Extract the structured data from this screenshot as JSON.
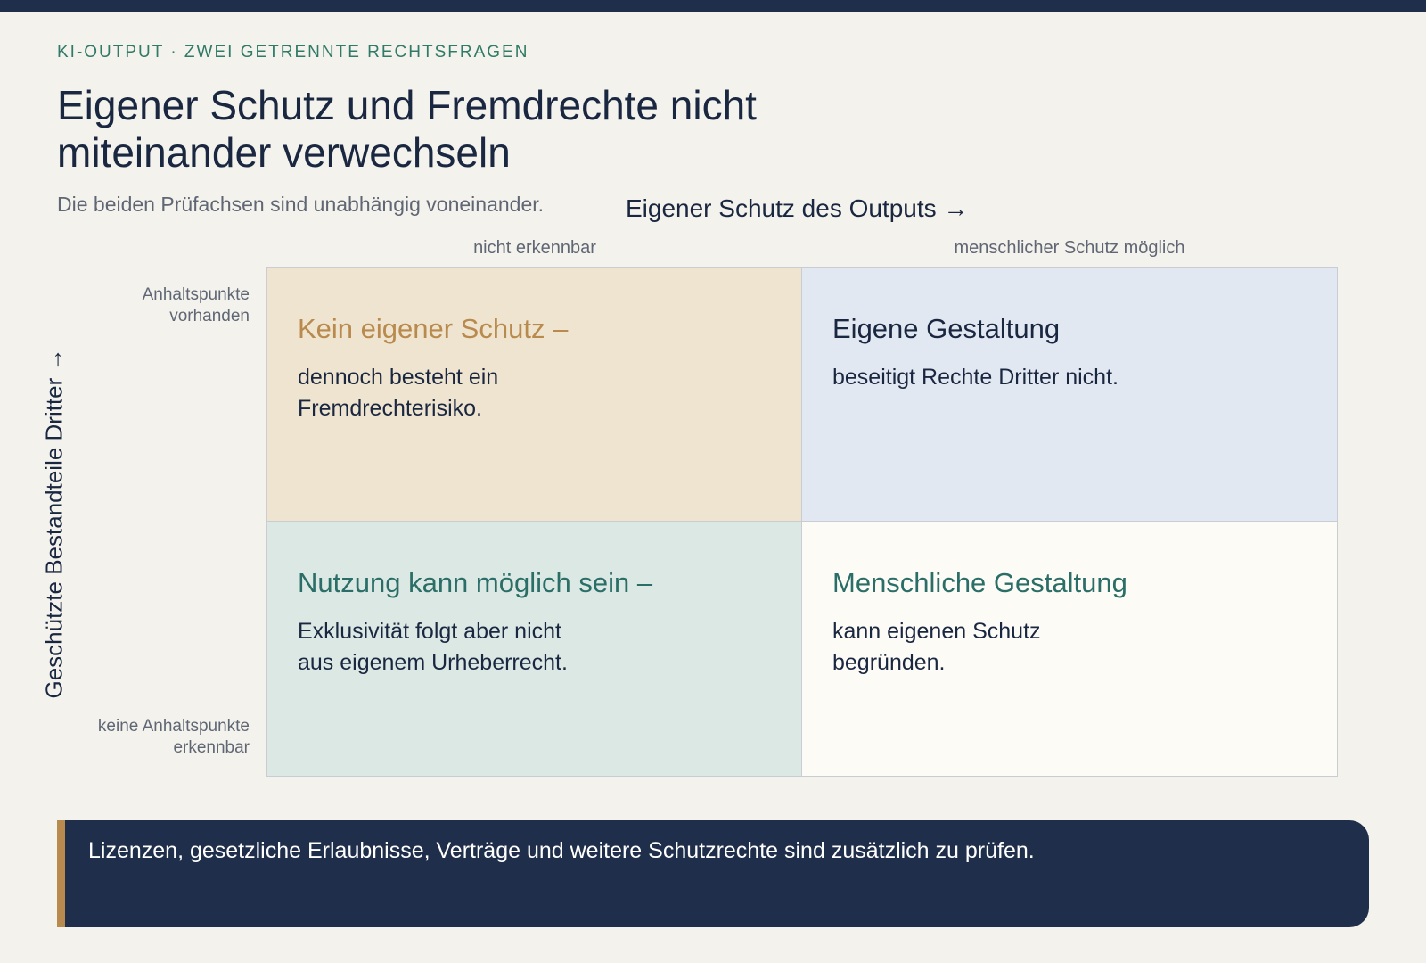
{
  "eyebrow": "KI-OUTPUT · ZWEI GETRENNTE RECHTSFRAGEN",
  "title": "Eigener Schutz und Fremdrechte nicht miteinander verwechseln",
  "subtitle": "Die beiden Prüfachsen sind unabhängig voneinander.",
  "x_axis": {
    "title": "Eigener Schutz des Outputs →",
    "columns": [
      "nicht erkennbar",
      "menschlicher Schutz möglich"
    ]
  },
  "y_axis": {
    "title": "Geschützte Bestandteile Dritter →",
    "rows": [
      "Anhaltspunkte vorhanden",
      "keine Anhaltspunkte erkennbar"
    ]
  },
  "quadrants": {
    "top_left": {
      "head": "Kein eigener Schutz –",
      "body": "dennoch besteht ein Fremdrechterisiko."
    },
    "top_right": {
      "head": "Eigene Gestaltung",
      "body": "beseitigt Rechte Dritter nicht."
    },
    "bottom_left": {
      "head": "Nutzung kann möglich sein –",
      "body": "Exklusivität folgt aber nicht aus eigenem Urheberrecht."
    },
    "bottom_right": {
      "head": "Menschliche Gestaltung",
      "body": "kann eigenen Schutz begründen."
    }
  },
  "note": "Lizenzen, gesetzliche Erlaubnisse, Verträge und weitere Schutzrechte sind zusätzlich zu prüfen.",
  "colors": {
    "navy": "#1f2e4a",
    "accent_gold": "#b98a4d",
    "accent_teal": "#2f7a68",
    "quadrant_tl": "#efe4cf",
    "quadrant_tr": "#e2e8f1",
    "quadrant_bl": "#dce8e4",
    "quadrant_br": "#fdfbf6"
  }
}
